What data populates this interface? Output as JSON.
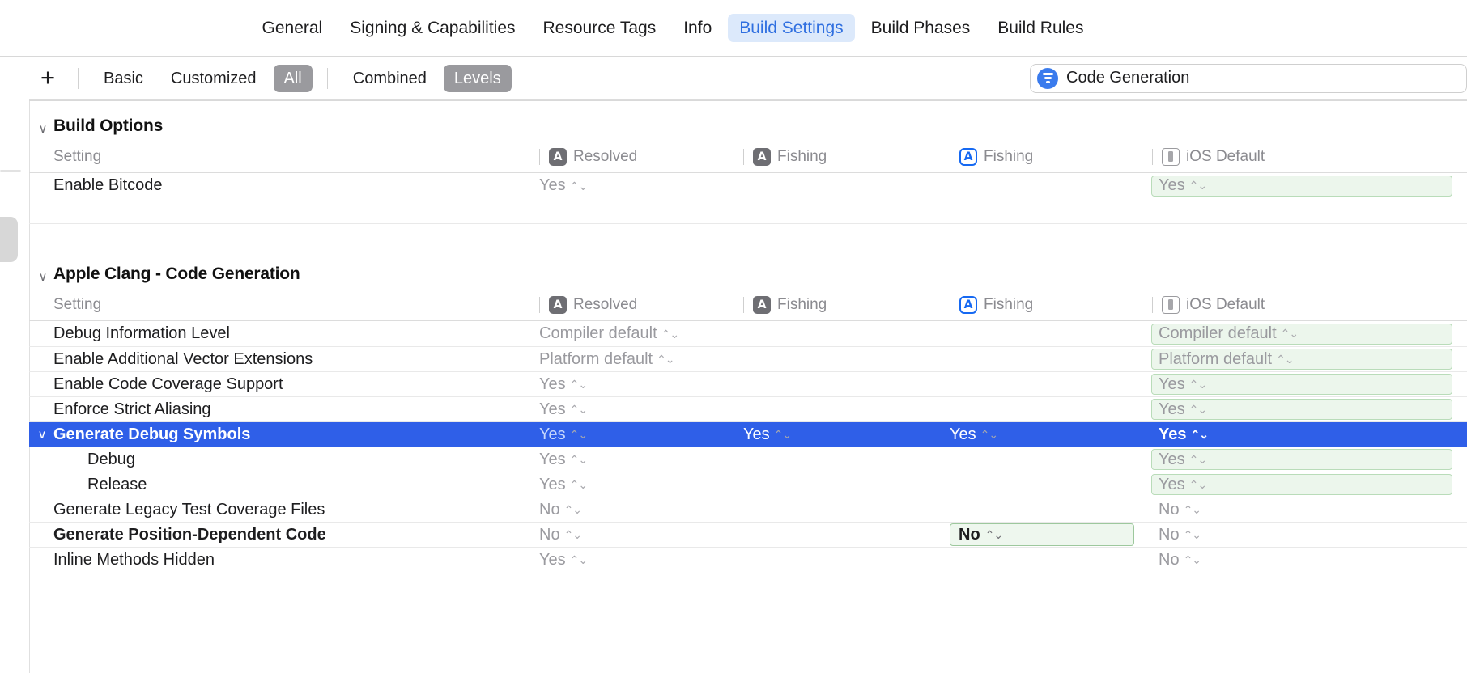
{
  "tabs": [
    {
      "label": "General",
      "active": false
    },
    {
      "label": "Signing & Capabilities",
      "active": false
    },
    {
      "label": "Resource Tags",
      "active": false
    },
    {
      "label": "Info",
      "active": false
    },
    {
      "label": "Build Settings",
      "active": true
    },
    {
      "label": "Build Phases",
      "active": false
    },
    {
      "label": "Build Rules",
      "active": false
    }
  ],
  "toolbar": {
    "add_label": "+",
    "scope": [
      {
        "label": "Basic",
        "on": false
      },
      {
        "label": "Customized",
        "on": false
      },
      {
        "label": "All",
        "on": true
      }
    ],
    "mode": [
      {
        "label": "Combined",
        "on": false
      },
      {
        "label": "Levels",
        "on": true
      }
    ],
    "search_value": "Code Generation",
    "filter_icon": "filter-icon"
  },
  "columns": {
    "setting": "Setting",
    "resolved": "Resolved",
    "target1": "Fishing",
    "target2": "Fishing",
    "ios_default": "iOS Default"
  },
  "groups": [
    {
      "title": "Build Options",
      "rows": [
        {
          "label": "Enable Bitcode",
          "indent": 0,
          "bold": false,
          "selected": false,
          "expandable": false,
          "resolved": "Yes",
          "target1": "",
          "target2": "",
          "ios_default": "Yes",
          "ios_highlight": true,
          "target2_focus": false
        }
      ]
    },
    {
      "title": "Apple Clang - Code Generation",
      "rows": [
        {
          "label": "Debug Information Level",
          "indent": 0,
          "bold": false,
          "selected": false,
          "expandable": false,
          "resolved": "Compiler default",
          "target1": "",
          "target2": "",
          "ios_default": "Compiler default",
          "ios_highlight": true,
          "target2_focus": false
        },
        {
          "label": "Enable Additional Vector Extensions",
          "indent": 0,
          "bold": false,
          "selected": false,
          "expandable": false,
          "resolved": "Platform default",
          "target1": "",
          "target2": "",
          "ios_default": "Platform default",
          "ios_highlight": true,
          "target2_focus": false
        },
        {
          "label": "Enable Code Coverage Support",
          "indent": 0,
          "bold": false,
          "selected": false,
          "expandable": false,
          "resolved": "Yes",
          "target1": "",
          "target2": "",
          "ios_default": "Yes",
          "ios_highlight": true,
          "target2_focus": false
        },
        {
          "label": "Enforce Strict Aliasing",
          "indent": 0,
          "bold": false,
          "selected": false,
          "expandable": false,
          "resolved": "Yes",
          "target1": "",
          "target2": "",
          "ios_default": "Yes",
          "ios_highlight": true,
          "target2_focus": false
        },
        {
          "label": "Generate Debug Symbols",
          "indent": 0,
          "bold": false,
          "selected": true,
          "expandable": true,
          "resolved": "Yes",
          "target1": "Yes",
          "target2": "Yes",
          "ios_default": "Yes",
          "ios_highlight": true,
          "target2_focus": false
        },
        {
          "label": "Debug",
          "indent": 1,
          "bold": false,
          "selected": false,
          "expandable": false,
          "resolved": "Yes",
          "target1": "",
          "target2": "",
          "ios_default": "Yes",
          "ios_highlight": true,
          "target2_focus": false
        },
        {
          "label": "Release",
          "indent": 1,
          "bold": false,
          "selected": false,
          "expandable": false,
          "resolved": "Yes",
          "target1": "",
          "target2": "",
          "ios_default": "Yes",
          "ios_highlight": true,
          "target2_focus": false
        },
        {
          "label": "Generate Legacy Test Coverage Files",
          "indent": 0,
          "bold": false,
          "selected": false,
          "expandable": false,
          "resolved": "No",
          "target1": "",
          "target2": "",
          "ios_default": "No",
          "ios_highlight": false,
          "target2_focus": false
        },
        {
          "label": "Generate Position-Dependent Code",
          "indent": 0,
          "bold": true,
          "selected": false,
          "expandable": false,
          "resolved": "No",
          "target1": "",
          "target2": "No",
          "ios_default": "No",
          "ios_highlight": false,
          "target2_focus": true
        },
        {
          "label": "Inline Methods Hidden",
          "indent": 0,
          "bold": false,
          "selected": false,
          "expandable": false,
          "resolved": "Yes",
          "target1": "",
          "target2": "",
          "ios_default": "No",
          "ios_highlight": false,
          "target2_focus": false
        }
      ]
    }
  ],
  "stepper_glyph": "⌃⌄",
  "colors": {
    "accent_blue": "#2f5fe8",
    "tab_active_text": "#2f6fe0",
    "tab_active_bg": "#dce9fb",
    "segment_on_bg": "#9a9a9e",
    "green_border": "#b9dcb9",
    "green_bg": "#ecf6ec"
  }
}
